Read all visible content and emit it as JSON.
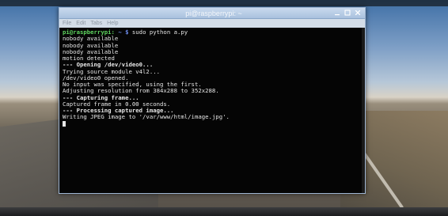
{
  "window": {
    "title": "pi@raspberrypi: ~",
    "controls": [
      "minimize",
      "maximize",
      "close"
    ]
  },
  "menubar": {
    "items": [
      "File",
      "Edit",
      "Tabs",
      "Help"
    ]
  },
  "terminal": {
    "prompt_user": "pi@raspberrypi:",
    "prompt_path": "~ $",
    "command": " sudo python a.py",
    "lines": [
      {
        "text": "nobody available",
        "bold": false
      },
      {
        "text": "nobody available",
        "bold": false
      },
      {
        "text": "nobody available",
        "bold": false
      },
      {
        "text": "motion detected",
        "bold": false
      },
      {
        "text": "--- Opening /dev/video0...",
        "bold": true
      },
      {
        "text": "Trying source module v4l2...",
        "bold": false
      },
      {
        "text": "/dev/video0 opened.",
        "bold": false
      },
      {
        "text": "No input was specified, using the first.",
        "bold": false
      },
      {
        "text": "Adjusting resolution from 384x288 to 352x288.",
        "bold": false
      },
      {
        "text": "--- Capturing frame...",
        "bold": true
      },
      {
        "text": "Captured frame in 0.00 seconds.",
        "bold": false
      },
      {
        "text": "--- Processing captured image...",
        "bold": true
      },
      {
        "text": "Writing JPEG image to '/var/www/html/image.jpg'.",
        "bold": false
      }
    ]
  },
  "colors": {
    "terminal_bg": "#050505",
    "prompt_user": "#5fd45f",
    "prompt_path": "#6f8ff0",
    "titlebar": "#a9c1de"
  },
  "icons": {
    "minimize": "minimize-icon",
    "maximize": "maximize-icon",
    "close": "close-icon"
  }
}
